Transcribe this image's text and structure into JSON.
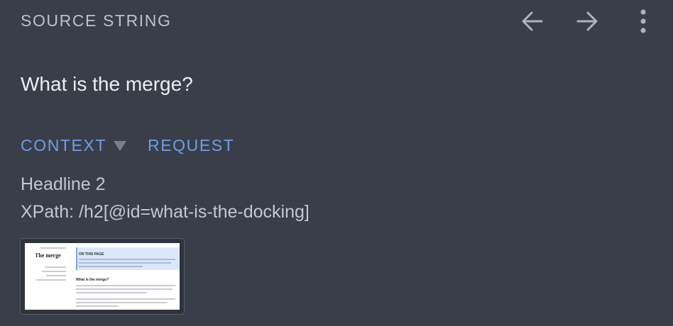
{
  "header": {
    "title": "SOURCE STRING",
    "icons": {
      "back": "arrow-left-icon",
      "forward": "arrow-right-icon",
      "more": "more-vertical-icon"
    }
  },
  "source": {
    "text": "What is the merge?"
  },
  "tabs": [
    {
      "label": "CONTEXT",
      "active": true
    },
    {
      "label": "REQUEST",
      "active": false
    }
  ],
  "context": {
    "type_label": "Headline 2",
    "xpath": "XPath: /h2[@id=what-is-the-docking]"
  },
  "thumbnail": {
    "title": "The merge",
    "callout_title": "ON THIS PAGE",
    "heading": "What is the merge?"
  },
  "colors": {
    "background": "#393e48",
    "accent": "#6f9ce8",
    "header_text": "#bdc1c8",
    "body_text": "#c4c8ce"
  }
}
